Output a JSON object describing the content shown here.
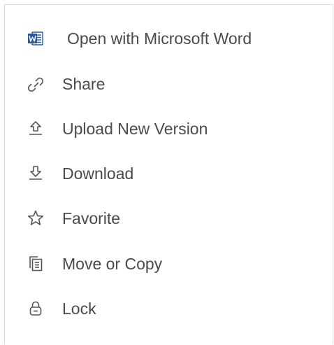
{
  "menu": {
    "items": [
      {
        "id": "open-word",
        "label": "Open with Microsoft Word",
        "icon": "word-icon",
        "icon_color": "#2b579a"
      },
      {
        "id": "share",
        "label": "Share",
        "icon": "link-icon"
      },
      {
        "id": "upload",
        "label": "Upload New Version",
        "icon": "upload-icon"
      },
      {
        "id": "download",
        "label": "Download",
        "icon": "download-icon"
      },
      {
        "id": "favorite",
        "label": "Favorite",
        "icon": "star-icon"
      },
      {
        "id": "move-copy",
        "label": "Move or Copy",
        "icon": "copy-icon"
      },
      {
        "id": "lock",
        "label": "Lock",
        "icon": "lock-icon"
      }
    ],
    "text_color": "#4a4a4a"
  }
}
